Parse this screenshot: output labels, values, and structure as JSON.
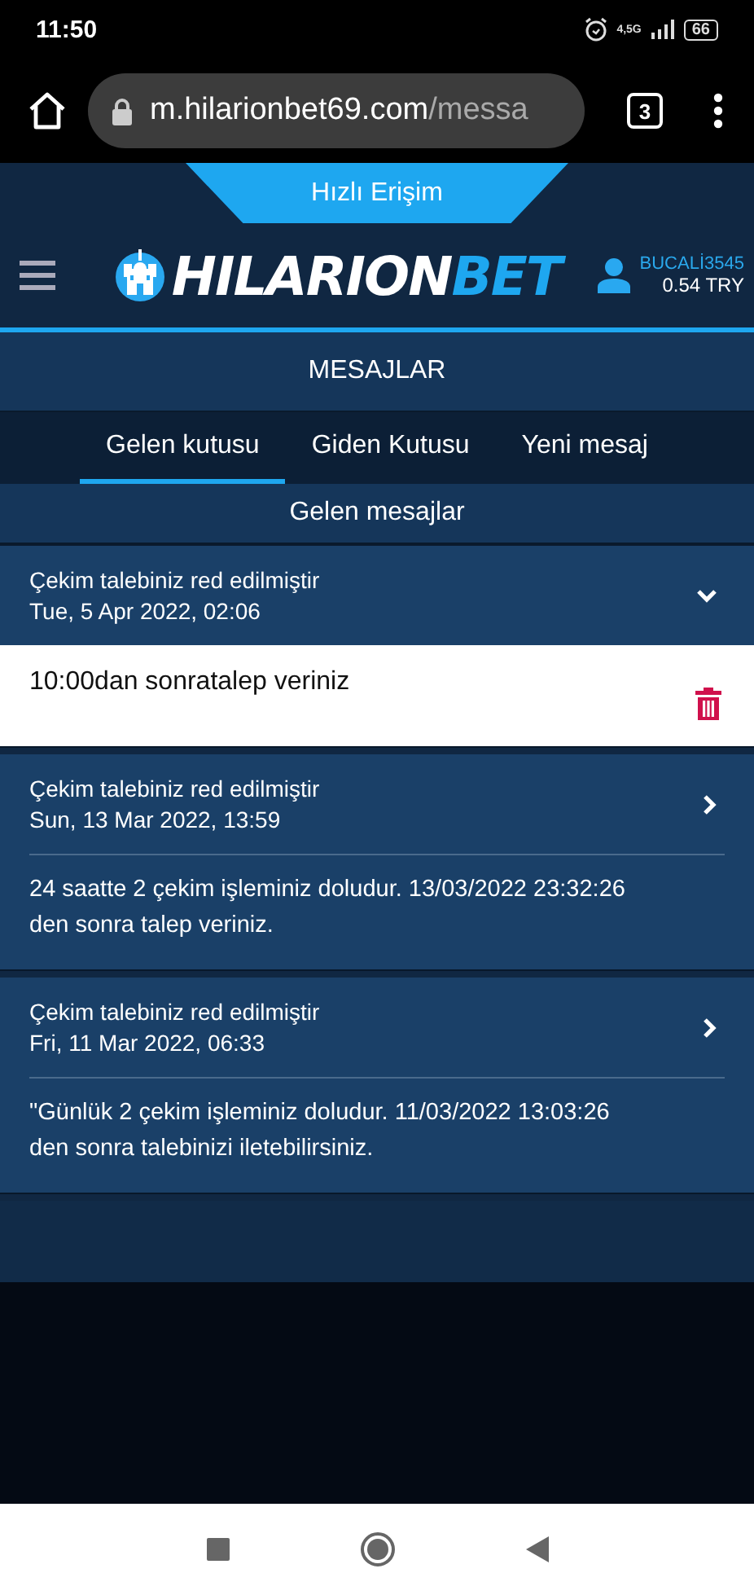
{
  "status_bar": {
    "time": "11:50",
    "network": "4,5G",
    "battery": "66"
  },
  "browser": {
    "url_host": "m.hilarionbet69.com",
    "url_path": "/messa",
    "tab_count": "3"
  },
  "quick_access": {
    "label": "Hızlı Erişim"
  },
  "header": {
    "logo_main": "HILARION",
    "logo_accent": "BET",
    "username": "BUCALİ3545",
    "balance": "0.54 TRY"
  },
  "page_title": "MESAJLAR",
  "tabs": [
    {
      "label": "Gelen kutusu",
      "selected": true
    },
    {
      "label": "Giden Kutusu",
      "selected": false
    },
    {
      "label": "Yeni mesaj",
      "selected": false
    }
  ],
  "section_title": "Gelen mesajlar",
  "messages": [
    {
      "subject": "Çekim talebiniz red edilmiştir",
      "date": "Tue, 5 Apr 2022, 02:06",
      "body": "10:00dan sonratalep veriniz",
      "expanded": true
    },
    {
      "subject": "Çekim talebiniz red edilmiştir",
      "date": "Sun, 13 Mar 2022, 13:59",
      "body": "24 saatte 2 çekim işleminiz doludur. 13/03/2022 23:32:26 den sonra talep veriniz.",
      "expanded": false
    },
    {
      "subject": "Çekim talebiniz red edilmiştir",
      "date": "Fri, 11 Mar 2022, 06:33",
      "body": "\"Günlük 2 çekim işleminiz doludur. 11/03/2022 13:03:26 den sonra talebinizi iletebilirsiniz.",
      "expanded": false
    }
  ]
}
